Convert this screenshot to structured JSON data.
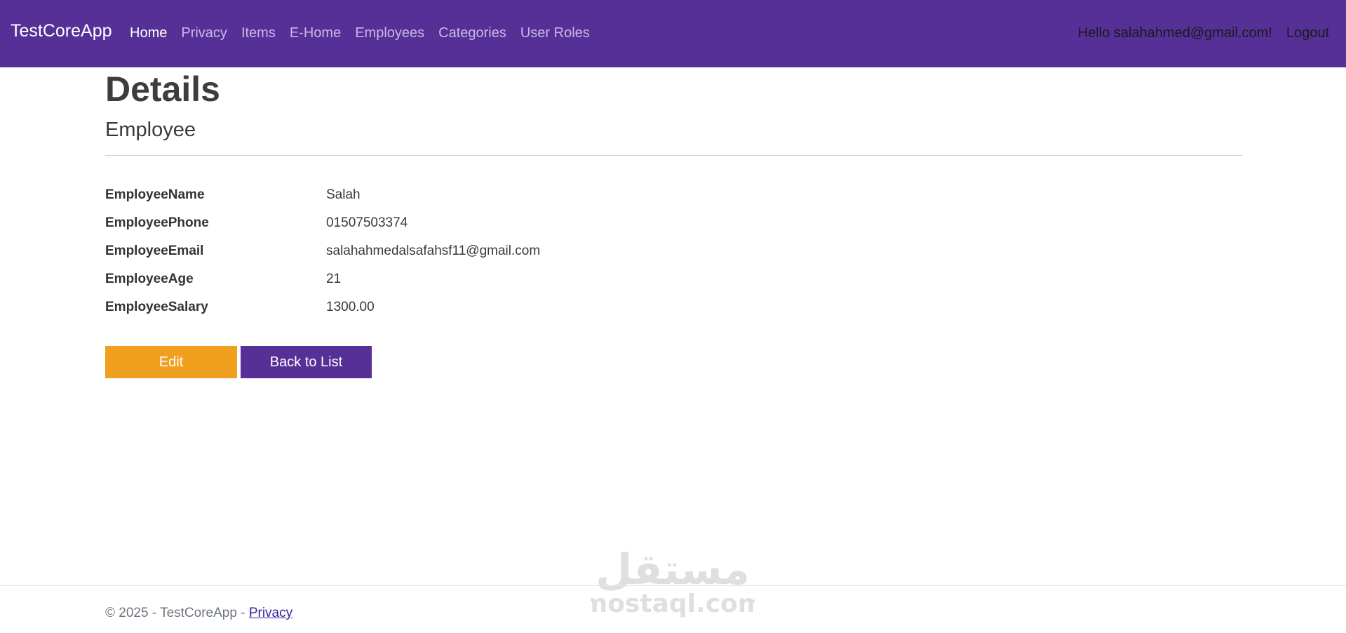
{
  "navbar": {
    "brand": "TestCoreApp",
    "links": [
      {
        "label": "Home",
        "active": true
      },
      {
        "label": "Privacy",
        "active": false
      },
      {
        "label": "Items",
        "active": false
      },
      {
        "label": "E-Home",
        "active": false
      },
      {
        "label": "Employees",
        "active": false
      },
      {
        "label": "Categories",
        "active": false
      },
      {
        "label": "User Roles",
        "active": false
      }
    ],
    "greeting": "Hello salahahmed@gmail.com!",
    "logout": "Logout"
  },
  "page": {
    "title": "Details",
    "subtitle": "Employee"
  },
  "details": [
    {
      "label": "EmployeeName",
      "value": "Salah"
    },
    {
      "label": "EmployeePhone",
      "value": "01507503374"
    },
    {
      "label": "EmployeeEmail",
      "value": "salahahmedalsafahsf11@gmail.com"
    },
    {
      "label": "EmployeeAge",
      "value": "21"
    },
    {
      "label": "EmployeeSalary",
      "value": "1300.00"
    }
  ],
  "actions": {
    "edit": "Edit",
    "back": "Back to List"
  },
  "footer": {
    "text": "© 2025 - TestCoreApp - ",
    "privacy": "Privacy"
  },
  "watermark": {
    "arabic": "مستقل",
    "latin": "mostaql.com"
  },
  "colors": {
    "navbar": "#563097",
    "edit_button": "#f0a01e",
    "back_button": "#563097"
  }
}
